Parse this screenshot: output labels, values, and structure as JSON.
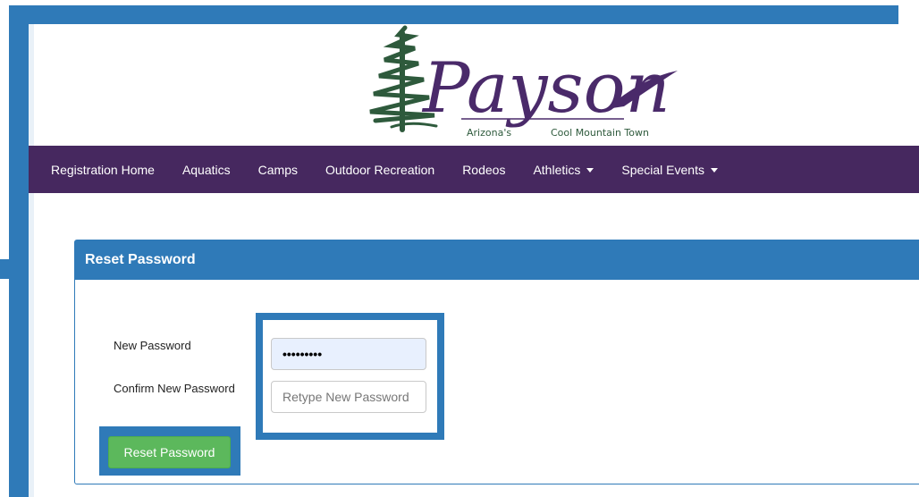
{
  "colors": {
    "nav_bg": "#46285f",
    "panel_accent": "#2f7ab8",
    "button_green": "#5cb85c",
    "logo_purple": "#4a2a6a",
    "logo_green": "#2e5a3c"
  },
  "logo": {
    "title": "Payson",
    "tagline_left": "Arizona's",
    "tagline_right": "Cool Mountain Town"
  },
  "nav": {
    "items": [
      {
        "label": "Registration Home",
        "dropdown": false
      },
      {
        "label": "Aquatics",
        "dropdown": false
      },
      {
        "label": "Camps",
        "dropdown": false
      },
      {
        "label": "Outdoor Recreation",
        "dropdown": false
      },
      {
        "label": "Rodeos",
        "dropdown": false
      },
      {
        "label": "Athletics",
        "dropdown": true
      },
      {
        "label": "Special Events",
        "dropdown": true
      }
    ]
  },
  "panel": {
    "title": "Reset Password"
  },
  "form": {
    "new_password_label": "New Password",
    "new_password_value": "•••••••••",
    "confirm_label": "Confirm New Password",
    "confirm_placeholder": "Retype New Password",
    "confirm_value": "",
    "submit_label": "Reset Password"
  }
}
